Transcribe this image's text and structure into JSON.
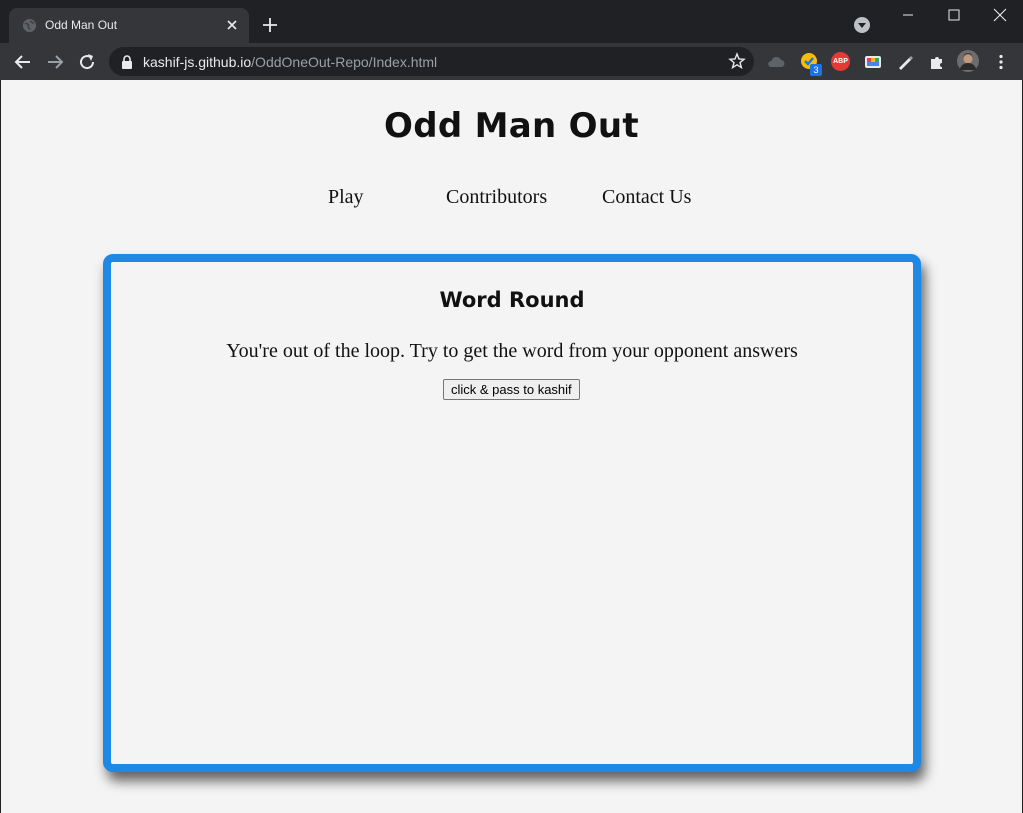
{
  "browser": {
    "tab": {
      "title": "Odd Man Out"
    },
    "address": {
      "host": "kashif-js.github.io",
      "path": "/OddOneOut-Repo/Index.html"
    },
    "extensions": {
      "todo_badge": "3",
      "adblock_label": "ABP"
    }
  },
  "page": {
    "title": "Odd Man Out",
    "nav": {
      "play": "Play",
      "contributors": "Contributors",
      "contact": "Contact Us"
    },
    "card": {
      "title": "Word Round",
      "message": "You're out of the loop. Try to get the word from your opponent answers",
      "button": "click & pass to kashif"
    }
  },
  "colors": {
    "card_border": "#1e88e5",
    "page_background": "#f4f4f4",
    "browser_frame": "#202124",
    "toolbar": "#35363a"
  }
}
